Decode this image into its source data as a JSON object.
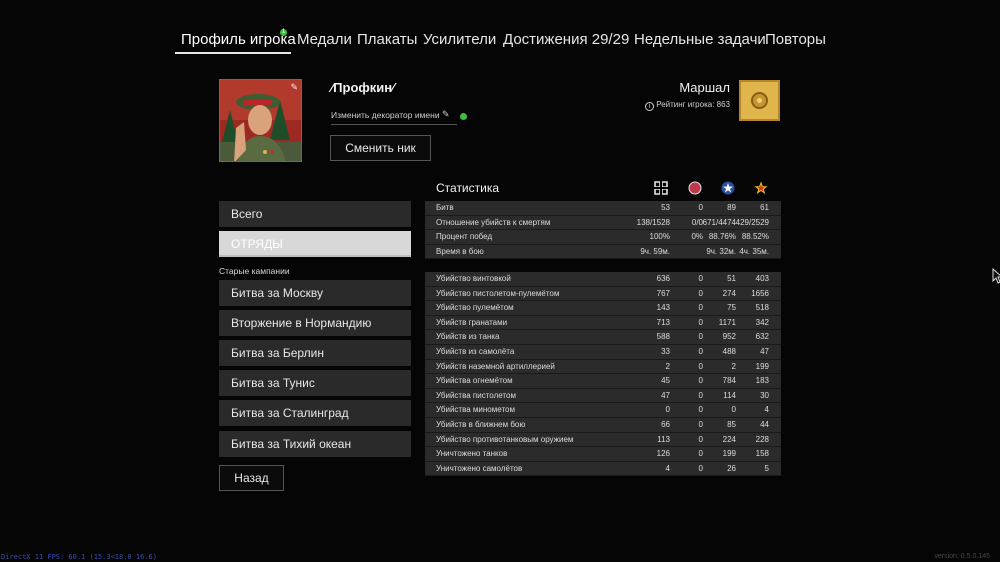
{
  "nav": {
    "tabs": [
      {
        "label": "Профиль игрока",
        "badge": "1"
      },
      {
        "label": "Медали"
      },
      {
        "label": "Плакаты"
      },
      {
        "label": "Усилители"
      },
      {
        "label": "Достижения 29/29"
      },
      {
        "label": "Недельные задачи"
      },
      {
        "label": "Повторы"
      }
    ]
  },
  "profile": {
    "name": "⁄Профкин⁄",
    "decorator_label": "Изменить декоратор имени",
    "change_nick_label": "Сменить ник",
    "rank_title": "Маршал",
    "rating_label": "Рейтинг игрока: 863"
  },
  "menu": {
    "total": "Всего",
    "squads": "ОТРЯДЫ",
    "section_label": "Старые кампании",
    "campaigns": [
      "Битва за Москву",
      "Вторжение в Нормандию",
      "Битва за Берлин",
      "Битва за Тунис",
      "Битва за Сталинград",
      "Битва за Тихий океан"
    ],
    "back_label": "Назад"
  },
  "stats": {
    "title": "Статистика",
    "columns": [
      "axis-cross-icon",
      "japan-circle-icon",
      "usa-star-icon",
      "ussr-star-icon"
    ],
    "colors": {
      "japan": "#c0394b",
      "usa": "#2b4ea3",
      "ussr": "#d62b1f",
      "ussr_star": "#f2c230"
    },
    "summary": [
      {
        "label": "Битв",
        "values": [
          "53",
          "0",
          "89",
          "61"
        ]
      },
      {
        "label": "Отношение убийств к смертям",
        "values": [
          "138/1528",
          "0/0",
          "671/4474",
          "429/2529"
        ]
      },
      {
        "label": "Процент побед",
        "values": [
          "100%",
          "0%",
          "88.76%",
          "88.52%"
        ]
      },
      {
        "label": "Время в бою",
        "values": [
          "9ч. 59м.",
          "",
          "9ч. 32м.",
          "4ч. 35м."
        ]
      }
    ],
    "kills": [
      {
        "label": "Убийство винтовкой",
        "values": [
          "636",
          "0",
          "51",
          "403"
        ]
      },
      {
        "label": "Убийство пистолетом-пулемётом",
        "values": [
          "767",
          "0",
          "274",
          "1656"
        ]
      },
      {
        "label": "Убийство пулемётом",
        "values": [
          "143",
          "0",
          "75",
          "518"
        ]
      },
      {
        "label": "Убийств гранатами",
        "values": [
          "713",
          "0",
          "1171",
          "342"
        ]
      },
      {
        "label": "Убийств из танка",
        "values": [
          "588",
          "0",
          "952",
          "632"
        ]
      },
      {
        "label": "Убийств из самолёта",
        "values": [
          "33",
          "0",
          "488",
          "47"
        ]
      },
      {
        "label": "Убийств наземной артиллерией",
        "values": [
          "2",
          "0",
          "2",
          "199"
        ]
      },
      {
        "label": "Убийства огнемётом",
        "values": [
          "45",
          "0",
          "784",
          "183"
        ]
      },
      {
        "label": "Убийства пистолетом",
        "values": [
          "47",
          "0",
          "114",
          "30"
        ]
      },
      {
        "label": "Убийства минометом",
        "values": [
          "0",
          "0",
          "0",
          "4"
        ]
      },
      {
        "label": "Убийств в ближнем бою",
        "values": [
          "66",
          "0",
          "85",
          "44"
        ]
      },
      {
        "label": "Убийство противотанковым оружием",
        "values": [
          "113",
          "0",
          "224",
          "228"
        ]
      },
      {
        "label": "Уничтожено танков",
        "values": [
          "126",
          "0",
          "199",
          "158"
        ]
      },
      {
        "label": "Уничтожено самолётов",
        "values": [
          "4",
          "0",
          "26",
          "5"
        ]
      }
    ]
  },
  "footer": {
    "fps": "DirectX 11 FPS: 60.1 (15.3<18.0 16.6)",
    "version": "version: 0.5.0.145"
  }
}
